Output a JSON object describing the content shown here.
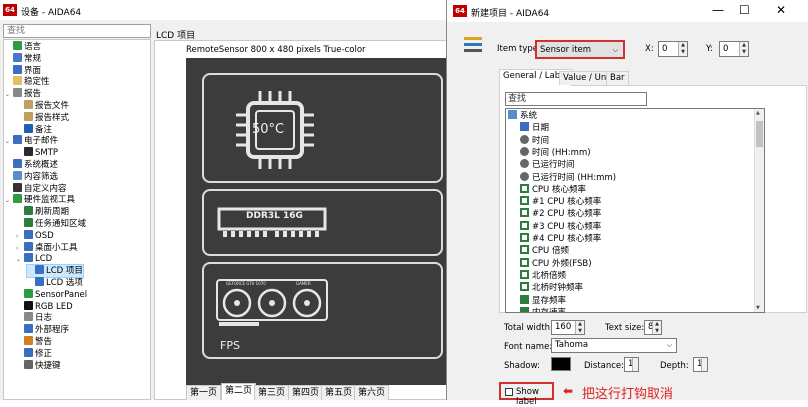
{
  "main": {
    "title": "设备 - AIDA64",
    "app_icon": "64",
    "search_placeholder": "查找",
    "tree": [
      {
        "label": "语言",
        "indent": 0,
        "icon": "globe-icon",
        "color": "#2e9c3e"
      },
      {
        "label": "常规",
        "indent": 0,
        "icon": "grid-icon",
        "color": "#4a78c8"
      },
      {
        "label": "界面",
        "indent": 0,
        "icon": "window-icon",
        "color": "#3a6fc0"
      },
      {
        "label": "稳定性",
        "indent": 0,
        "icon": "document-icon",
        "color": "#e0c060"
      },
      {
        "label": "报告",
        "indent": 0,
        "icon": "report-icon",
        "color": "#888888",
        "expanded": true
      },
      {
        "label": "报告文件",
        "indent": 1,
        "icon": "report-file-icon",
        "color": "#c0a060"
      },
      {
        "label": "报告样式",
        "indent": 1,
        "icon": "report-style-icon",
        "color": "#c0a060"
      },
      {
        "label": "备注",
        "indent": 1,
        "icon": "info-icon",
        "color": "#1e5fb0"
      },
      {
        "label": "电子邮件",
        "indent": 0,
        "icon": "email-icon",
        "color": "#3a6fc0",
        "expanded": true
      },
      {
        "label": "SMTP",
        "indent": 1,
        "icon": "smtp-icon",
        "color": "#2a2a2a"
      },
      {
        "label": "系统概述",
        "indent": 0,
        "icon": "system-icon",
        "color": "#3a6fc0"
      },
      {
        "label": "内容筛选",
        "indent": 0,
        "icon": "filter-icon",
        "color": "#5a8ad0"
      },
      {
        "label": "自定义内容",
        "indent": 0,
        "icon": "custom-icon",
        "color": "#333333"
      },
      {
        "label": "硬件监视工具",
        "indent": 0,
        "icon": "monitor-tool-icon",
        "color": "#2e9c3e",
        "expanded": true
      },
      {
        "label": "刷新周期",
        "indent": 1,
        "icon": "refresh-icon",
        "color": "#2e7c3e"
      },
      {
        "label": "任务通知区域",
        "indent": 1,
        "icon": "tray-icon",
        "color": "#2e7c3e"
      },
      {
        "label": "OSD",
        "indent": 1,
        "icon": "osd-icon",
        "color": "#3a6fc0",
        "collapsed": true
      },
      {
        "label": "桌面小工具",
        "indent": 1,
        "icon": "gadget-icon",
        "color": "#3a6fc0",
        "collapsed": true
      },
      {
        "label": "LCD",
        "indent": 1,
        "icon": "lcd-icon",
        "color": "#3a6fc0",
        "expanded": true
      },
      {
        "label": "LCD 项目",
        "indent": 2,
        "icon": "lcd-item-icon",
        "color": "#3a6fc0",
        "selected": true
      },
      {
        "label": "LCD 选项",
        "indent": 2,
        "icon": "lcd-options-icon",
        "color": "#3a6fc0"
      },
      {
        "label": "SensorPanel",
        "indent": 1,
        "icon": "sensorpanel-icon",
        "color": "#2e9c3e"
      },
      {
        "label": "RGB LED",
        "indent": 1,
        "icon": "rgb-led-icon",
        "color": "#111111"
      },
      {
        "label": "日志",
        "indent": 1,
        "icon": "log-icon",
        "color": "#888888"
      },
      {
        "label": "外部程序",
        "indent": 1,
        "icon": "external-program-icon",
        "color": "#3a6fc0"
      },
      {
        "label": "警告",
        "indent": 1,
        "icon": "warning-icon",
        "color": "#d08020"
      },
      {
        "label": "修正",
        "indent": 1,
        "icon": "correction-icon",
        "color": "#3a6fc0"
      },
      {
        "label": "快捷键",
        "indent": 1,
        "icon": "hotkey-icon",
        "color": "#666666"
      }
    ],
    "lcd_header": "LCD 项目",
    "lcd_info": "RemoteSensor 800 x 480 pixels True-color",
    "lcd_panels": {
      "cpu_temp": "50°C",
      "ram_label": "DDR3L 16G",
      "gpu_brand": "GEFORCE GTX 1070",
      "gpu_maker": "GAMER",
      "fps_label": "FPS"
    },
    "pages": [
      "第一页",
      "第二页",
      "第三页",
      "第四页",
      "第五页",
      "第六页"
    ],
    "active_page": 1
  },
  "dialog": {
    "title": "新建项目 - AIDA64",
    "app_icon": "64",
    "controls": {
      "minimize": "—",
      "maximize": "☐",
      "close": "✕"
    },
    "item_type_label": "Item type:",
    "item_type_value": "Sensor item",
    "x_label": "X:",
    "x_value": "0",
    "y_label": "Y:",
    "y_value": "0",
    "tabs": [
      "General / Label",
      "Value / Unit",
      "Bar"
    ],
    "search_value": "查找",
    "sensor_items": [
      {
        "label": "系统",
        "indent": 0,
        "icon": "computer-icon",
        "color": "#5a8ad0"
      },
      {
        "label": "日期",
        "indent": 1,
        "icon": "calendar-icon",
        "color": "#3a6fc0"
      },
      {
        "label": "时间",
        "indent": 1,
        "icon": "clock-icon",
        "color": "#555555"
      },
      {
        "label": "时间 (HH:mm)",
        "indent": 1,
        "icon": "clock-icon",
        "color": "#555555"
      },
      {
        "label": "已运行时间",
        "indent": 1,
        "icon": "clock-icon",
        "color": "#555555"
      },
      {
        "label": "已运行时间 (HH:mm)",
        "indent": 1,
        "icon": "clock-icon",
        "color": "#555555"
      },
      {
        "label": "CPU 核心频率",
        "indent": 1,
        "icon": "cpu-icon",
        "color": "#2e7c3e"
      },
      {
        "label": "#1 CPU 核心频率",
        "indent": 1,
        "icon": "cpu-icon",
        "color": "#2e7c3e"
      },
      {
        "label": "#2 CPU 核心频率",
        "indent": 1,
        "icon": "cpu-icon",
        "color": "#2e7c3e"
      },
      {
        "label": "#3 CPU 核心频率",
        "indent": 1,
        "icon": "cpu-icon",
        "color": "#2e7c3e"
      },
      {
        "label": "#4 CPU 核心频率",
        "indent": 1,
        "icon": "cpu-icon",
        "color": "#2e7c3e"
      },
      {
        "label": "CPU 倍频",
        "indent": 1,
        "icon": "cpu-icon",
        "color": "#2e7c3e"
      },
      {
        "label": "CPU 外频(FSB)",
        "indent": 1,
        "icon": "cpu-icon",
        "color": "#2e7c3e"
      },
      {
        "label": "北桥倍频",
        "indent": 1,
        "icon": "chip-icon",
        "color": "#2e7c3e"
      },
      {
        "label": "北桥时钟频率",
        "indent": 1,
        "icon": "chip-icon",
        "color": "#2e7c3e"
      },
      {
        "label": "显存频率",
        "indent": 1,
        "icon": "memory-icon",
        "color": "#2e7c3e"
      },
      {
        "label": "内存速率",
        "indent": 1,
        "icon": "memory-icon",
        "color": "#2e7c3e"
      }
    ],
    "total_width_label": "Total width:",
    "total_width_value": "160",
    "text_size_label": "Text size:",
    "text_size_value": "8",
    "font_name_label": "Font name:",
    "font_name_value": "Tahoma",
    "shadow_label": "Shadow:",
    "shadow_color": "#000000",
    "distance_label": "Distance:",
    "distance_value": "1",
    "depth_label": "Depth:",
    "depth_value": "1",
    "show_label": "Show label",
    "annotation": "把这行打钩取消",
    "annotation_color": "#e02020"
  }
}
